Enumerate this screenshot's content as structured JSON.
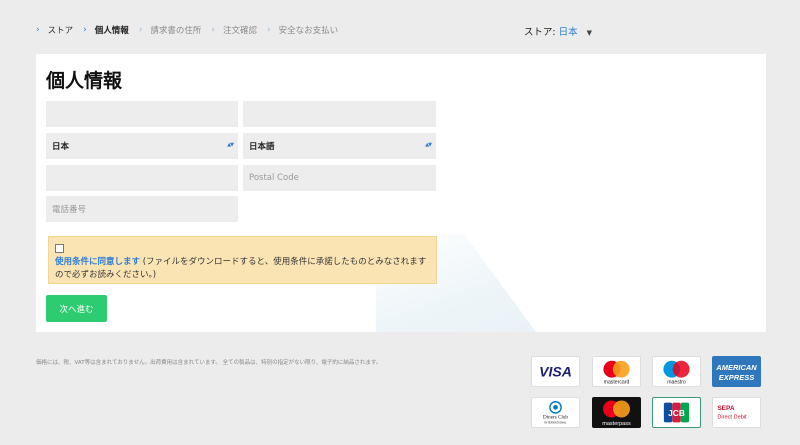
{
  "breadcrumb": {
    "items": [
      {
        "label": "ストア",
        "style": "dark"
      },
      {
        "label": "個人情報",
        "style": "bold"
      },
      {
        "label": "請求書の住所",
        "style": "muted"
      },
      {
        "label": "注文確認",
        "style": "muted"
      },
      {
        "label": "安全なお支払い",
        "style": "muted"
      }
    ]
  },
  "store_selector": {
    "label": "ストア:",
    "value": "日本"
  },
  "form": {
    "title": "個人情報",
    "country_value": "日本",
    "language_value": "日本語",
    "postal_placeholder": "Postal Code",
    "phone_placeholder": "電話番号",
    "terms": {
      "link_text": "使用条件に同意します",
      "body_text": " (ファイルをダウンロードすると、使用条件に承諾したものとみなされますので必ずお読みください。)"
    },
    "next_button": "次へ進む"
  },
  "footer": {
    "note": "価格には、税、VAT等は含まれておりません。出荷費用は含まれています。 全ての製品は、特別の指定がない限り、電子的に納品されます。"
  },
  "payment_methods": {
    "visa": "VISA",
    "mastercard": "mastercard",
    "maestro": "maestro",
    "amex_1": "AMERICAN",
    "amex_2": "EXPRESS",
    "diners_1": "Diners Club",
    "diners_2": "INTERNATIONAL",
    "masterpass": "masterpass",
    "jcb": "JCB",
    "sepa_1": "SEPA",
    "sepa_2": "Direct Debit"
  },
  "colors": {
    "accent": "#2e7fd2",
    "button": "#2ecc71",
    "notice_bg": "#fbe4b4"
  }
}
